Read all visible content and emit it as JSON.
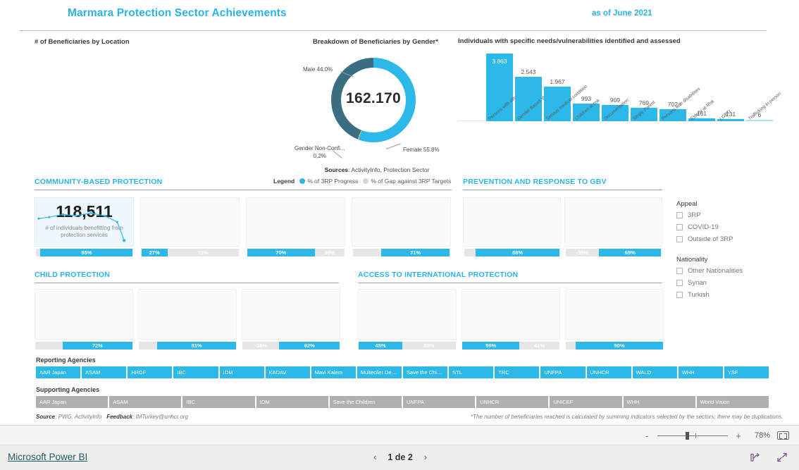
{
  "report": {
    "title": "Marmara Protection Sector Achievements",
    "as_of": "as of June 2021",
    "accent": "#2bb3e8",
    "captions": {
      "location": "# of Beneficiaries by Location",
      "gender": "Breakdown of Beneficiaries by Gender*",
      "needs": "Individuals with specific needs/vulnerabilities identified and assessed"
    },
    "sources_text": "Sources: ActivityInfo, Protection Sector",
    "sources_bold": "Sources",
    "sources_rest": ": ActivityInfo, Protection Sector",
    "legend": {
      "title": "Legend",
      "progress": "% of 3RP Progress",
      "gap": "% of Gap against 3RP Targets",
      "progress_color": "#2cb8e9",
      "gap_color": "#d6d6d6"
    },
    "notes": {
      "source_label": "Source",
      "source_value": ": PWG, ActivityInfo",
      "feedback_label": "Feedback",
      "feedback_value": ": IMTurkey@unhcr.org",
      "footnote": "*The number of beneficiaries reached is calculated by summing indicators selected by the sectors; there may be duplications."
    }
  },
  "chart_data": [
    {
      "type": "pie",
      "title": "Breakdown of Beneficiaries by Gender*",
      "center_total": "162.170",
      "labels": [
        "Female",
        "Male",
        "Gender Non-Confi..."
      ],
      "values": [
        55.8,
        44.0,
        0.2
      ],
      "value_labels": [
        "Female 55.8%",
        "Male 44.0%",
        "Gender Non-Confi... 0,2%"
      ],
      "nonconf_line1": "Gender Non-Confi...",
      "nonconf_line2": "0,2%",
      "colors": [
        "#2cb8e9",
        "#3c6e82",
        "#d9cf6a"
      ],
      "legend_position": "none",
      "grid": false
    },
    {
      "type": "bar",
      "title": "Individuals with specific needs/vulnerabilities identified and assessed",
      "categories": [
        "Persons with other vul...",
        "Gender Based Violence",
        "Serious medical condition",
        "Children at risk",
        "Documentation",
        "Single Parent",
        "Persons with disabilities",
        "Elderly at Risk",
        "LGBTI",
        "Trafficking in person"
      ],
      "values": [
        3863,
        2543,
        1967,
        993,
        909,
        769,
        702,
        161,
        131,
        6
      ],
      "value_labels": [
        "3.863",
        "2.543",
        "1.967",
        "993",
        "909",
        "769",
        "702",
        "161",
        "131",
        "6"
      ],
      "xlabel": "",
      "ylabel": "",
      "ylim": [
        0,
        3863
      ],
      "grid": false,
      "legend_position": "none",
      "bar_color": "#2cb8e9",
      "last_bar_color": "#a8e0f4"
    }
  ],
  "sections": [
    {
      "id": "community-based-protection",
      "title": "COMMUNITY-BASED PROTECTION",
      "cards": [
        {
          "big_value": "118,511",
          "subtitle": "# of individuals benefitting from protection services",
          "highlight": true,
          "progress": "95%",
          "gap": "",
          "progress_pct": 95,
          "gap_pct": 0,
          "lead_empty_pct": 5
        },
        {
          "big_value": "",
          "subtitle": "",
          "highlight": false,
          "progress": "27%",
          "gap": "73%",
          "progress_pct": 27,
          "gap_pct": 73,
          "lead_empty_pct": 0
        },
        {
          "big_value": "",
          "subtitle": "",
          "highlight": false,
          "progress": "70%",
          "gap": "30%",
          "progress_pct": 70,
          "gap_pct": 30,
          "lead_empty_pct": 0
        },
        {
          "big_value": "",
          "subtitle": "",
          "highlight": false,
          "progress": "71%",
          "gap": "",
          "progress_pct": 71,
          "gap_pct": 0,
          "lead_empty_pct": 29
        }
      ]
    },
    {
      "id": "prevention-and-response-to-gbv",
      "title": "PREVENTION AND RESPONSE TO GBV",
      "cards": [
        {
          "big_value": "",
          "subtitle": "",
          "highlight": false,
          "progress": "88%",
          "gap": "",
          "progress_pct": 88,
          "gap_pct": 0,
          "lead_empty_pct": 12
        },
        {
          "big_value": "",
          "subtitle": "",
          "highlight": false,
          "progress": "65%",
          "gap": "-35%",
          "progress_pct": 65,
          "gap_pct": 35,
          "lead_empty_pct": 0,
          "gap_first": true
        }
      ]
    },
    {
      "id": "child-protection",
      "title": "CHILD PROTECTION",
      "cards": [
        {
          "big_value": "",
          "subtitle": "",
          "highlight": false,
          "progress": "72%",
          "gap": "",
          "progress_pct": 72,
          "gap_pct": 0,
          "lead_empty_pct": 28
        },
        {
          "big_value": "",
          "subtitle": "",
          "highlight": false,
          "progress": "81%",
          "gap": "",
          "progress_pct": 81,
          "gap_pct": 0,
          "lead_empty_pct": 19
        },
        {
          "big_value": "",
          "subtitle": "",
          "highlight": false,
          "progress": "62%",
          "gap": "-38%",
          "progress_pct": 62,
          "gap_pct": 38,
          "lead_empty_pct": 0,
          "gap_first": true
        }
      ]
    },
    {
      "id": "access-to-international-protection",
      "title": "ACCESS TO INTERNATIONAL PROTECTION",
      "cards": [
        {
          "big_value": "",
          "subtitle": "",
          "highlight": false,
          "progress": "45%",
          "gap": "55%",
          "progress_pct": 45,
          "gap_pct": 55,
          "lead_empty_pct": 0
        },
        {
          "big_value": "",
          "subtitle": "",
          "highlight": false,
          "progress": "59%",
          "gap": "41%",
          "progress_pct": 59,
          "gap_pct": 41,
          "lead_empty_pct": 0
        },
        {
          "big_value": "",
          "subtitle": "",
          "highlight": false,
          "progress": "90%",
          "gap": "",
          "progress_pct": 90,
          "gap_pct": 0,
          "lead_empty_pct": 10
        }
      ]
    }
  ],
  "filters": {
    "appeal": {
      "header": "Appeal",
      "options": [
        "3RP",
        "COVID-19",
        "Outside of 3RP"
      ]
    },
    "nationality": {
      "header": "Nationality",
      "options": [
        "Other Nationalities",
        "Syrian",
        "Turkish"
      ]
    }
  },
  "agencies": {
    "reporting_label": "Reporting Agencies",
    "reporting": [
      "AAR Japan",
      "ASAM",
      "HRDF",
      "IBC",
      "IOM",
      "KADAV",
      "Mavi Kalem",
      "Multeciler De…",
      "Save the Chi…",
      "STL",
      "TRC",
      "UNFPA",
      "UNHCR",
      "WALD",
      "WHH",
      "YSF"
    ],
    "supporting_label": "Supporting Agencies",
    "supporting": [
      "AAR Japan",
      "ASAM",
      "IBC",
      "IOM",
      "Save the Children",
      "UNFPA",
      "UNHCR",
      "UNICEF",
      "WHH",
      "World Vision"
    ]
  },
  "statusbar": {
    "zoom_out": "-",
    "zoom_in": "+",
    "zoom_level": "78%"
  },
  "pbi": {
    "logo": "Microsoft Power BI",
    "page_label": "1 de 2",
    "prev": "‹",
    "next": "›"
  }
}
